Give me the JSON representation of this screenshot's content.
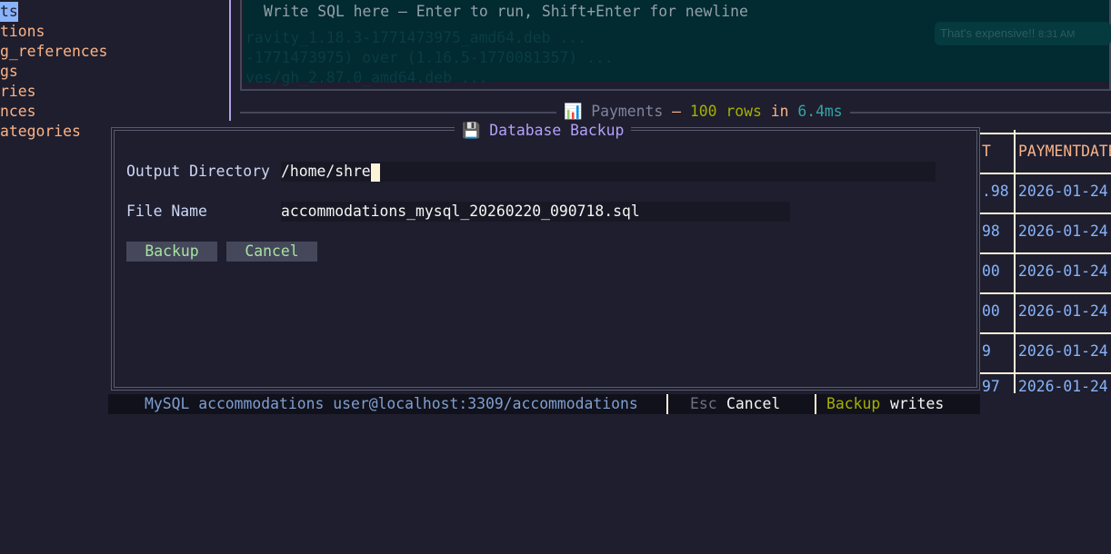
{
  "sidebar": {
    "items": [
      "ts",
      "tions",
      "g_references",
      "gs",
      "ries",
      "nces",
      "ategories"
    ]
  },
  "editor": {
    "placeholder": "Write SQL here — Enter to run, Shift+Enter for newline",
    "ghost_lines": [
      "ravity_1.18.3-1771473975_amd64.deb ...",
      "-1771473975) over (1.16.5-1770081357) ...",
      "ves/gh_2.87.0_amd64.deb ..."
    ],
    "overlay_message": "That's expensive!!",
    "overlay_time": "8:31 AM"
  },
  "results": {
    "icon": "bar-chart-icon",
    "table": "Payments",
    "sep": "—",
    "rows": "100 rows",
    "in": "in",
    "time": "6.4ms"
  },
  "table": {
    "headers": [
      "T",
      "PAYMENTDATE"
    ],
    "rows": [
      [
        ".98",
        "2026-01-24"
      ],
      [
        "98",
        "2026-01-24"
      ],
      [
        "00",
        "2026-01-24"
      ],
      [
        "00",
        "2026-01-24"
      ],
      [
        "9",
        "2026-01-24"
      ],
      [
        "97",
        "2026-01-24"
      ]
    ]
  },
  "modal": {
    "icon": "floppy-disk-icon",
    "title": "Database Backup",
    "output_dir_label": "Output Directory",
    "output_dir_value": "/home/shre",
    "file_name_label": "File Name",
    "file_name_value": "accommodations_mysql_20260220_090718.sql",
    "backup_button": "Backup",
    "cancel_button": "Cancel"
  },
  "status": {
    "connection": "MySQL accommodations user@localhost:3309/accommodations",
    "esc_key": "Esc",
    "esc_action": "Cancel",
    "backup_key": "Backup",
    "backup_action": "writes"
  }
}
